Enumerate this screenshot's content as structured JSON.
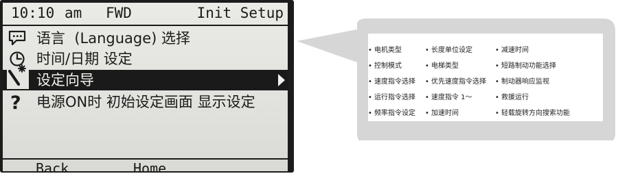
{
  "status_bar": {
    "time": "10:10",
    "ampm": "am",
    "direction": "FWD",
    "title": "Init Setup"
  },
  "menu": {
    "items": [
      {
        "label": "语言  (Language) 选择",
        "icon": "speech-bubble-icon",
        "selected": false
      },
      {
        "label": "时间/日期 设定",
        "icon": "clock-icon",
        "selected": false
      },
      {
        "label": "设定向导",
        "icon": "magic-wand-icon",
        "selected": true
      },
      {
        "label": "电源ON时 初始设定画面 显示设定",
        "icon": "question-mark-icon",
        "selected": false
      }
    ]
  },
  "softkeys": {
    "left": "Back",
    "right": "Home"
  },
  "callout": {
    "bullet": "•",
    "columns": [
      [
        "电机类型",
        "控制模式",
        "速度指令选择",
        "运行指令选择",
        "频率指令设定"
      ],
      [
        "长度单位设定",
        "电梯类型",
        "优先速度指令选择",
        "速度指令 1～",
        "加速时间"
      ],
      [
        "减速时间",
        "短路制动功能选择",
        "制动器响应监视",
        "救援运行",
        "轻载旋转方向搜索功能"
      ]
    ]
  },
  "colors": {
    "lcd_background": "#e4e4e0",
    "lcd_text": "#1a1a1a",
    "frame": "#1c1c1c",
    "callout_fill": "#d6d6d6"
  }
}
